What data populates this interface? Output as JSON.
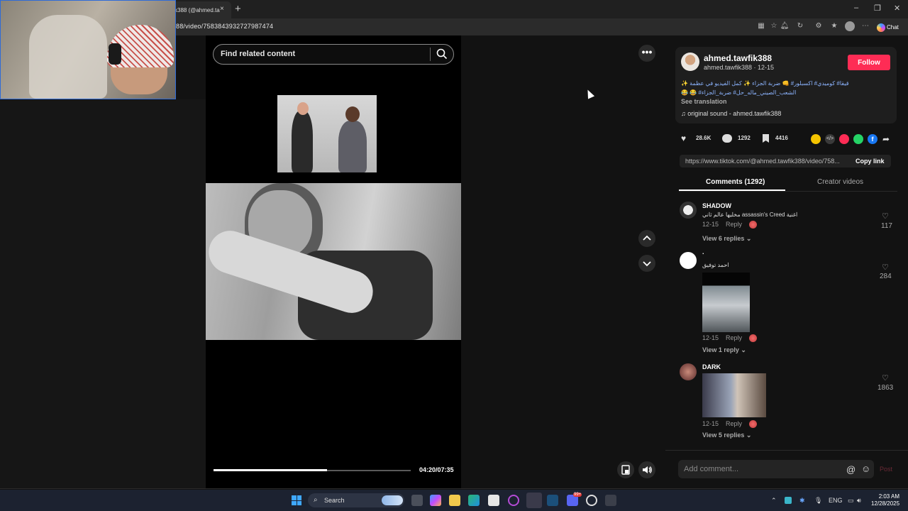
{
  "browser": {
    "tab_title": "k388 (@ahmed.ta",
    "tab_close": "×",
    "new_tab": "+",
    "url": "88/video/7583843932727987474",
    "chat_label": "Chat",
    "window_controls": {
      "minimize": "–",
      "maximize": "❐",
      "close": "✕"
    }
  },
  "video": {
    "search_placeholder": "Find related content",
    "time": "04:20/07:35",
    "progress": 0.575,
    "more": "•••",
    "up": "⌃",
    "down": "⌄"
  },
  "creator": {
    "name": "ahmed.tawfik388",
    "handle_date": "ahmed.tawfik388 · 12-15",
    "follow": "Follow",
    "description": "قيقا# كوميدي# اكسبلور# 👊 ضربة الجزاء ✨ كمل الفيديو في عظمة ✨ الشعب_الصيني_ماله_حل# ضربة_الجزاء# 😂 😂",
    "see_translation": "See translation",
    "sound": "original sound - ahmed.tawfik388"
  },
  "stats": {
    "likes": "28.6K",
    "comments": "1292",
    "saves": "4416"
  },
  "share": {
    "link": "https://www.tiktok.com/@ahmed.tawfik388/video/758...",
    "copy": "Copy link",
    "colors": [
      "#f5c400",
      "#3a3a3a",
      "#fe2c55",
      "#25d366",
      "#1877f2"
    ]
  },
  "tabs": {
    "comments": "Comments (1292)",
    "creator_videos": "Creator videos"
  },
  "comments": [
    {
      "name": "SHADOW",
      "text": "اغنية assassin's Creed مخليها عالم ثاني",
      "date": "12-15",
      "reply": "Reply",
      "likes": "117",
      "views": "View 6 replies ⌄"
    },
    {
      "name": ".",
      "text": "احمد توفيق",
      "date": "12-15",
      "reply": "Reply",
      "likes": "284",
      "views": "View 1 reply ⌄"
    },
    {
      "name": "DARK",
      "text": "",
      "date": "12-15",
      "reply": "Reply",
      "likes": "1863",
      "views": "View 5 replies ⌄"
    }
  ],
  "add_comment": {
    "placeholder": "Add comment...",
    "at": "@",
    "emoji": "☺",
    "post": "Post"
  },
  "taskbar": {
    "search": "Search",
    "lang": "ENG",
    "time": "2:03 AM",
    "date": "12/28/2025",
    "badge": "99+"
  }
}
